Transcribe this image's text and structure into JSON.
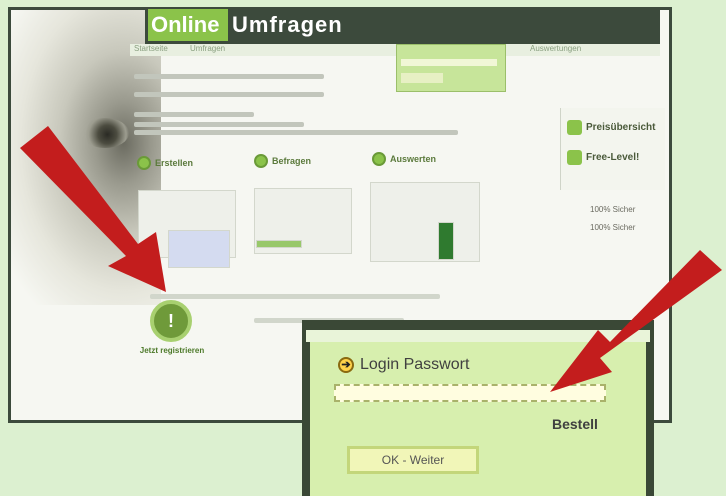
{
  "logo": {
    "part1": "Online",
    "part2": "Umfragen"
  },
  "nav": {
    "items": [
      "Startseite",
      "Umfragen",
      "Auswertungen"
    ]
  },
  "features": [
    {
      "label": "Erstellen"
    },
    {
      "label": "Befragen"
    },
    {
      "label": "Auswerten"
    }
  ],
  "right_panel": {
    "item1": "Preisübersicht",
    "item2": "Free-Level!"
  },
  "stats": {
    "line1": "100% Sicher",
    "line2": "100% Sicher"
  },
  "badge": {
    "label": "Jetzt registrieren"
  },
  "login_zoom": {
    "title": "Login Passwort",
    "field_placeholder": "",
    "forgot_link": "Bestell",
    "button": "OK - Weiter"
  },
  "colors": {
    "accent": "#8bc34a",
    "frame": "#3c4a3c",
    "arrow": "#c31d1d",
    "background": "#dcf0d0"
  }
}
